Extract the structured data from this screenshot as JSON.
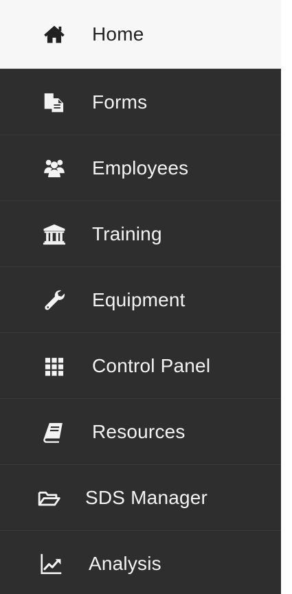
{
  "menu": {
    "items": [
      {
        "label": "Home",
        "icon": "home-icon",
        "active": true
      },
      {
        "label": "Forms",
        "icon": "forms-icon",
        "active": false
      },
      {
        "label": "Employees",
        "icon": "employees-icon",
        "active": false
      },
      {
        "label": "Training",
        "icon": "training-icon",
        "active": false
      },
      {
        "label": "Equipment",
        "icon": "wrench-icon",
        "active": false
      },
      {
        "label": "Control Panel",
        "icon": "grid-icon",
        "active": false
      },
      {
        "label": "Resources",
        "icon": "book-icon",
        "active": false
      },
      {
        "label": "SDS Manager",
        "icon": "folder-open-icon",
        "active": false
      },
      {
        "label": "Analysis",
        "icon": "chart-line-icon",
        "active": false
      }
    ]
  },
  "colors": {
    "sidebar_bg": "#2e2e2e",
    "active_bg": "#f7f7f7",
    "active_text": "#222222",
    "text": "#f3f3f3"
  }
}
